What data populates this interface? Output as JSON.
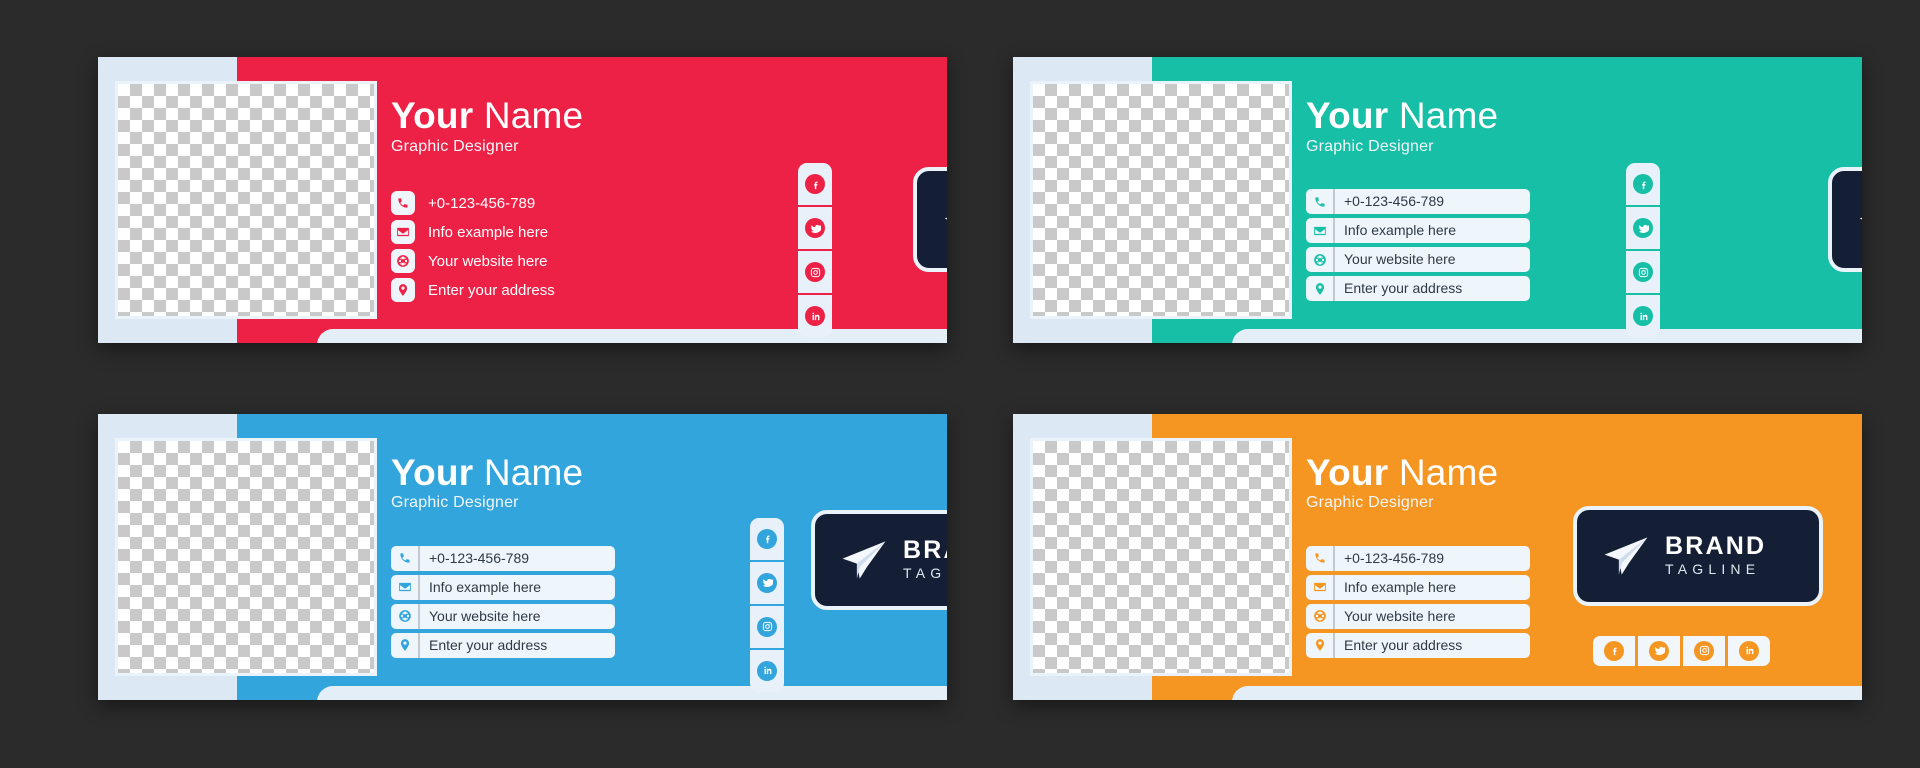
{
  "page": {
    "background_color": "#2b2b2b",
    "layout": "2x2 grid of email signature banner templates",
    "logo_navy": "#141f35",
    "panel_light": "#dce9f4"
  },
  "identity": {
    "name_first": "Your",
    "name_last": "Name",
    "role": "Graphic Designer"
  },
  "contacts": [
    {
      "icon": "phone-icon",
      "text": "+0-123-456-789"
    },
    {
      "icon": "email-icon",
      "text": "Info example here"
    },
    {
      "icon": "globe-icon",
      "text": "Your website here"
    },
    {
      "icon": "location-icon",
      "text": "Enter your address"
    }
  ],
  "social": [
    {
      "icon": "facebook-icon",
      "label": "Facebook"
    },
    {
      "icon": "twitter-icon",
      "label": "Twitter"
    },
    {
      "icon": "instagram-icon",
      "label": "Instagram"
    },
    {
      "icon": "linkedin-icon",
      "label": "LinkedIn"
    }
  ],
  "logo": {
    "icon": "paper-plane-icon",
    "brand": "BRAND",
    "tagline": "TAGLINE"
  },
  "cards": [
    {
      "id": "card-red",
      "accent_color": "#ed2145",
      "social_orientation": "vertical",
      "contacts_style": "plain",
      "logo_visible": "partial-right",
      "logo_shows_text": false
    },
    {
      "id": "card-teal",
      "accent_color": "#16bfa6",
      "social_orientation": "vertical",
      "contacts_style": "boxed",
      "logo_visible": "partial-right",
      "logo_shows_text": false
    },
    {
      "id": "card-blue",
      "accent_color": "#32a5dd",
      "social_orientation": "vertical",
      "contacts_style": "boxed",
      "logo_visible": "full",
      "logo_shows_text": true
    },
    {
      "id": "card-orange",
      "accent_color": "#f59623",
      "social_orientation": "horizontal",
      "contacts_style": "boxed",
      "logo_visible": "full",
      "logo_shows_text": true
    }
  ]
}
